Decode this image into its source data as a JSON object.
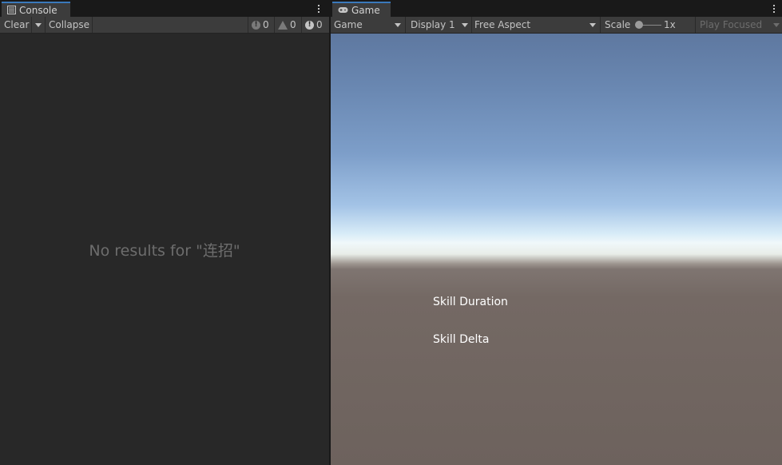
{
  "console": {
    "tab_label": "Console",
    "toolbar": {
      "clear_label": "Clear",
      "collapse_label": "Collapse",
      "error_count": "0",
      "warning_count": "0",
      "info_count": "0"
    },
    "empty_message": "No results for \"连招\""
  },
  "game": {
    "tab_label": "Game",
    "toolbar": {
      "view_mode": "Game",
      "display": "Display 1",
      "aspect": "Free Aspect",
      "scale_label": "Scale",
      "scale_value": "1x",
      "play_mode": "Play Focused"
    },
    "labels": {
      "skill_duration": "Skill Duration",
      "skill_delta": "Skill Delta"
    }
  },
  "colors": {
    "accent": "#3a79bb",
    "panel_bg": "#282828",
    "toolbar_bg": "#3c3c3c"
  }
}
